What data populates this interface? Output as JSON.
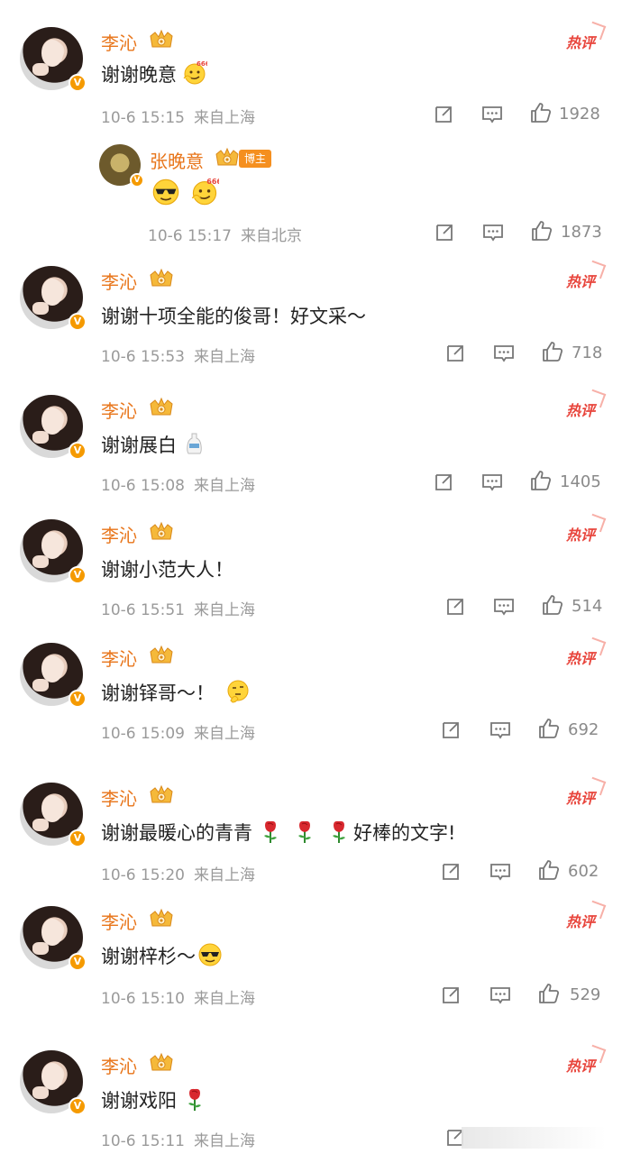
{
  "user": {
    "name": "李沁",
    "badge": "V"
  },
  "hot_label": "热评",
  "reply_badge": "博主",
  "comments": [
    {
      "text": "谢谢晚意",
      "emoji": "666-icon",
      "time": "10-6 15:15",
      "location": "来自上海",
      "likes": "1928",
      "reply": {
        "name": "张晚意",
        "emoji": [
          "sunglasses-icon",
          "666-icon"
        ],
        "time": "10-6 15:17",
        "location": "来自北京",
        "likes": "1873"
      }
    },
    {
      "text": "谢谢十项全能的俊哥！好文采～",
      "time": "10-6 15:53",
      "location": "来自上海",
      "likes": "718"
    },
    {
      "text": "谢谢展白",
      "emoji": "sake-icon",
      "time": "10-6 15:08",
      "location": "来自上海",
      "likes": "1405"
    },
    {
      "text": "谢谢小范大人！",
      "time": "10-6 15:51",
      "location": "来自上海",
      "likes": "514"
    },
    {
      "text": "谢谢铎哥～！",
      "emoji": "thinking-icon",
      "time": "10-6 15:09",
      "location": "来自上海",
      "likes": "692"
    },
    {
      "text_a": "谢谢最暖心的青青",
      "text_b": "好棒的文字!",
      "emoji": "rose-icon",
      "time": "10-6 15:20",
      "location": "来自上海",
      "likes": "602"
    },
    {
      "text": "谢谢梓杉～",
      "emoji": "sunglasses-icon",
      "time": "10-6 15:10",
      "location": "来自上海",
      "likes": "529"
    },
    {
      "text": "谢谢戏阳",
      "emoji": "rose-icon",
      "time": "10-6 15:11",
      "location": "来自上海",
      "likes": ""
    }
  ]
}
